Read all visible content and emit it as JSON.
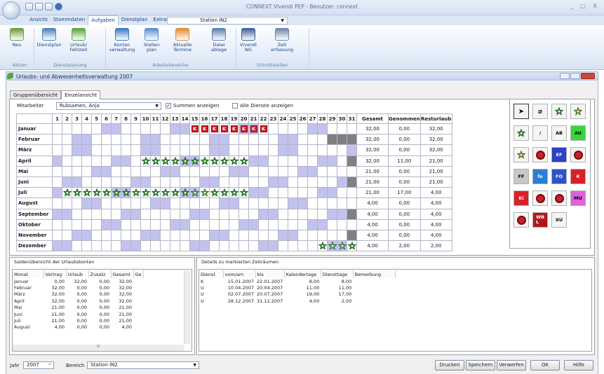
{
  "app": {
    "title": "CONNEXT Vivendi PEP - Benutzer: connext",
    "window_controls": "_ ▢ X"
  },
  "menu": {
    "tabs": [
      "Ansicht",
      "Stammdaten",
      "Aufgaben",
      "Dienstplan",
      "Extras"
    ],
    "active": "Aufgaben",
    "station": "Station IN2"
  },
  "ribbon": {
    "buttons": [
      {
        "label": "Neu",
        "icon": "new-document-icon",
        "color": "#6d9e3a"
      },
      {
        "label": "Dienstplan",
        "icon": "calendar-icon",
        "color": "#4f81bd"
      },
      {
        "label": "Urlaub/\nFehlzeit",
        "icon": "palm-tree-icon",
        "color": "#5aa540"
      },
      {
        "label": "Konten\nverwaltung",
        "icon": "accounts-icon",
        "color": "#3a78c2"
      },
      {
        "label": "Stellen\nplan",
        "icon": "staff-plan-icon",
        "color": "#5b8fd0"
      },
      {
        "label": "Aktuelle\nTermine",
        "icon": "appointments-icon",
        "color": "#e38b2c"
      },
      {
        "label": "Datei\nablage",
        "icon": "file-storage-icon",
        "color": "#5b7fb0"
      },
      {
        "label": "Vivendi\nNG",
        "icon": "vivendi-icon",
        "color": "#3d5f9a"
      },
      {
        "label": "Zeit\nerfassung",
        "icon": "stopwatch-icon",
        "color": "#6e86a8"
      }
    ],
    "groups": [
      "Aktion",
      "Dienstplanung",
      "Arbeitsbereiche",
      "Schnittstellen"
    ]
  },
  "subwindow": {
    "title": "Urlaubs- und Abwesenheitsverwaltung 2007"
  },
  "view_tabs": [
    "Gruppenübersicht",
    "Einzelansicht"
  ],
  "filters": {
    "mitarbeiter_label": "Mitarbeiter",
    "mitarbeiter_value": "Rubsamen, Anja",
    "summen_label": "Summen anzeigen",
    "summen_checked": true,
    "alle_dienste_label": "Alle Dienste anzeigen",
    "alle_dienste_checked": false
  },
  "calendar": {
    "days": [
      "1",
      "2",
      "3",
      "4",
      "5",
      "6",
      "7",
      "8",
      "9",
      "10",
      "11",
      "12",
      "13",
      "14",
      "15",
      "16",
      "17",
      "18",
      "19",
      "20",
      "21",
      "22",
      "23",
      "24",
      "25",
      "26",
      "27",
      "28",
      "29",
      "30",
      "31"
    ],
    "col_gesamt": "Gesamt",
    "col_genommen": "Genommen",
    "col_resturlaub": "Resturlaub",
    "months": [
      {
        "name": "Januar",
        "weekends": [
          6,
          7,
          13,
          14,
          20,
          21,
          27,
          28
        ],
        "days_in_month": 31,
        "marks": {
          "15": "K",
          "16": "K",
          "17": "K",
          "18": "K",
          "19": "K",
          "20": "K",
          "21": "K",
          "22": "K"
        },
        "gesamt": "32,00",
        "genommen": "0,00",
        "rest": "32,00"
      },
      {
        "name": "Februar",
        "weekends": [
          3,
          4,
          10,
          11,
          17,
          18,
          24,
          25
        ],
        "days_in_month": 28,
        "marks": {},
        "gesamt": "32,00",
        "genommen": "0,00",
        "rest": "32,00"
      },
      {
        "name": "März",
        "weekends": [
          3,
          4,
          10,
          11,
          17,
          18,
          24,
          25,
          31
        ],
        "days_in_month": 31,
        "marks": {},
        "gesamt": "32,00",
        "genommen": "0,00",
        "rest": "32,00"
      },
      {
        "name": "April",
        "weekends": [
          1,
          7,
          8,
          14,
          15,
          21,
          22,
          28,
          29
        ],
        "days_in_month": 30,
        "marks": {
          "10": "U",
          "11": "U",
          "12": "U",
          "13": "U",
          "14": "U",
          "15": "U",
          "16": "U",
          "17": "U",
          "18": "U",
          "19": "U",
          "20": "U"
        },
        "gesamt": "32,00",
        "genommen": "11,00",
        "rest": "21,00"
      },
      {
        "name": "Mai",
        "weekends": [
          5,
          6,
          12,
          13,
          19,
          20,
          26,
          27
        ],
        "days_in_month": 31,
        "marks": {},
        "gesamt": "21,00",
        "genommen": "0,00",
        "rest": "21,00"
      },
      {
        "name": "Juni",
        "weekends": [
          2,
          3,
          9,
          10,
          16,
          17,
          23,
          24,
          30
        ],
        "days_in_month": 30,
        "marks": {},
        "gesamt": "21,00",
        "genommen": "0,00",
        "rest": "21,00"
      },
      {
        "name": "Juli",
        "weekends": [
          1,
          7,
          8,
          14,
          15,
          21,
          22,
          28,
          29
        ],
        "days_in_month": 31,
        "marks": {
          "2": "U",
          "3": "U",
          "4": "U",
          "5": "U",
          "6": "U",
          "7": "U",
          "8": "U",
          "9": "U",
          "10": "U",
          "11": "U",
          "12": "U",
          "13": "U",
          "14": "U",
          "15": "Ug",
          "16": "Ug",
          "17": "U",
          "18": "U",
          "19": "U",
          "20": "U"
        },
        "gesamt": "21,00",
        "genommen": "17,00",
        "rest": "4,00"
      },
      {
        "name": "August",
        "weekends": [
          4,
          5,
          11,
          12,
          18,
          19,
          25,
          26
        ],
        "days_in_month": 31,
        "marks": {},
        "gesamt": "4,00",
        "genommen": "0,00",
        "rest": "4,00"
      },
      {
        "name": "September",
        "weekends": [
          1,
          2,
          8,
          9,
          15,
          16,
          22,
          23,
          29,
          30
        ],
        "days_in_month": 30,
        "marks": {},
        "gesamt": "4,00",
        "genommen": "0,00",
        "rest": "4,00"
      },
      {
        "name": "Oktober",
        "weekends": [
          6,
          7,
          13,
          14,
          20,
          21,
          27,
          28
        ],
        "days_in_month": 31,
        "marks": {},
        "gesamt": "4,00",
        "genommen": "0,00",
        "rest": "4,00"
      },
      {
        "name": "November",
        "weekends": [
          3,
          4,
          10,
          11,
          17,
          18,
          24,
          25
        ],
        "days_in_month": 30,
        "marks": {},
        "gesamt": "4,00",
        "genommen": "0,00",
        "rest": "4,00"
      },
      {
        "name": "Dezember",
        "weekends": [
          1,
          2,
          8,
          9,
          15,
          16,
          22,
          23,
          29,
          30
        ],
        "days_in_month": 31,
        "marks": {
          "28": "U",
          "29": "Ug",
          "30": "Ug",
          "31": "U"
        },
        "gesamt": "4,00",
        "genommen": "2,00",
        "rest": "2,00"
      }
    ]
  },
  "tools": [
    {
      "label": "",
      "icon": "pointer-icon",
      "bg": "#f4f4f4",
      "fg": "#000"
    },
    {
      "label": "",
      "icon": "eraser-icon",
      "bg": "#f4f4f4",
      "fg": "#000"
    },
    {
      "label": "",
      "icon": "green-star-icon",
      "bg": "#f4f4f4",
      "fg": "#000"
    },
    {
      "label": "",
      "icon": "orange-star-icon",
      "bg": "#f4f4f4",
      "fg": "#000"
    },
    {
      "label": "",
      "icon": "green-star-icon",
      "bg": "#f4f4f4",
      "fg": "#000"
    },
    {
      "label": "/",
      "icon": "slash-icon",
      "bg": "#f4f4f4",
      "fg": "#000"
    },
    {
      "label": "AB",
      "icon": "ab-icon",
      "bg": "#f4f4f4",
      "fg": "#000"
    },
    {
      "label": "AU",
      "icon": "au-icon",
      "bg": "#34d63a",
      "fg": "#000"
    },
    {
      "label": "",
      "icon": "orange-star-icon",
      "bg": "#f4f4f4",
      "fg": "#000"
    },
    {
      "label": "",
      "icon": "red-badge-icon",
      "bg": "#f4f4f4",
      "fg": "#000"
    },
    {
      "label": "EF",
      "icon": "ef-icon",
      "bg": "#2f3fc8",
      "fg": "#fff"
    },
    {
      "label": "",
      "icon": "red-badge-icon",
      "bg": "#f4f4f4",
      "fg": "#000"
    },
    {
      "label": "FF",
      "icon": "ff-icon",
      "bg": "#c8c8c8",
      "fg": "#000"
    },
    {
      "label": "fo",
      "icon": "fo-icon",
      "bg": "#2a7fd4",
      "fg": "#fff"
    },
    {
      "label": "FO",
      "icon": "fo-caps-icon",
      "bg": "#2f52c8",
      "fg": "#fff"
    },
    {
      "label": "K",
      "icon": "k-icon",
      "bg": "#d8202a",
      "fg": "#fff"
    },
    {
      "label": "Ki",
      "icon": "ki-icon",
      "bg": "#d8202a",
      "fg": "#fff"
    },
    {
      "label": "",
      "icon": "red-badge-icon",
      "bg": "#f4f4f4",
      "fg": "#000"
    },
    {
      "label": "",
      "icon": "red-badge-icon",
      "bg": "#f4f4f4",
      "fg": "#000"
    },
    {
      "label": "MU",
      "icon": "mu-icon",
      "bg": "#e060e0",
      "fg": "#000"
    },
    {
      "label": "",
      "icon": "red-badge-icon",
      "bg": "#f4f4f4",
      "fg": "#000"
    },
    {
      "label": "WB\nL",
      "icon": "wbl-icon",
      "bg": "#b01818",
      "fg": "#fff"
    },
    {
      "label": "XU",
      "icon": "xu-icon",
      "bg": "#f4f4f4",
      "fg": "#000"
    }
  ],
  "salden": {
    "title": "Saldenübersicht der Urlaubskonten",
    "headers": [
      "Monat",
      "Vortrag",
      "Urlaub",
      "Zusatz",
      "Gesamt",
      "Ge"
    ],
    "rows": [
      [
        "Januar",
        "0,00",
        "32,00",
        "0,00",
        "32,00"
      ],
      [
        "Februar",
        "32,00",
        "0,00",
        "0,00",
        "32,00"
      ],
      [
        "März",
        "32,00",
        "0,00",
        "0,00",
        "32,00"
      ],
      [
        "April",
        "32,00",
        "0,00",
        "0,00",
        "32,00"
      ],
      [
        "Mai",
        "21,00",
        "0,00",
        "0,00",
        "21,00"
      ],
      [
        "Juni",
        "21,00",
        "0,00",
        "0,00",
        "21,00"
      ],
      [
        "Juli",
        "21,00",
        "0,00",
        "0,00",
        "21,00"
      ],
      [
        "August",
        "4,00",
        "0,00",
        "0,00",
        "4,00"
      ]
    ],
    "scroll_mid": "III"
  },
  "details": {
    "title": "Details zu markierten Zeiträumen",
    "headers": [
      "Dienst",
      "vom/am",
      "bis",
      "Kalendertage",
      "Diensttage",
      "Bemerkung"
    ],
    "rows": [
      [
        "K",
        "15.01.2007",
        "22.01.2007",
        "8,00",
        "8,00"
      ],
      [
        "U",
        "10.04.2007",
        "20.04.2007",
        "11,00",
        "11,00"
      ],
      [
        "U",
        "02.07.2007",
        "20.07.2007",
        "19,00",
        "17,00"
      ],
      [
        "U",
        "28.12.2007",
        "31.12.2007",
        "4,00",
        "2,00"
      ]
    ]
  },
  "bottom": {
    "jahr_label": "Jahr",
    "jahr_value": "2007",
    "bereich_label": "Bereich",
    "bereich_value": "Station IN2",
    "buttons": [
      "Drucken",
      "Speichern",
      "Verwerfen",
      "OK",
      "Hilfe"
    ]
  }
}
